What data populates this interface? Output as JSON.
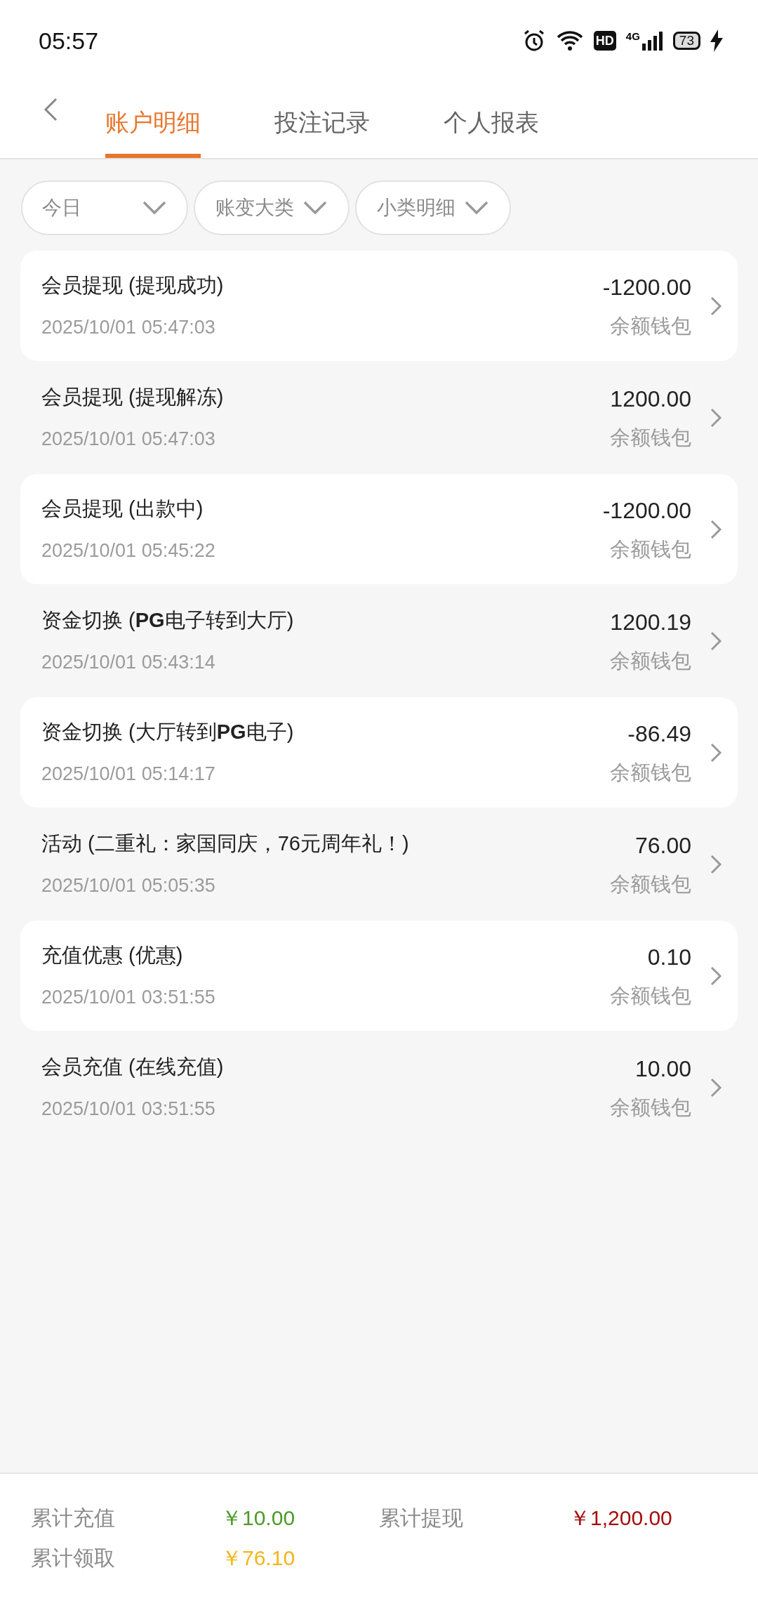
{
  "status_bar": {
    "time": "05:57",
    "hd": "HD",
    "network": "4G",
    "battery": "73"
  },
  "tabs": [
    {
      "label": "账户明细",
      "selected": true
    },
    {
      "label": "投注记录",
      "selected": false
    },
    {
      "label": "个人报表",
      "selected": false
    }
  ],
  "filters": [
    {
      "label": "今日"
    },
    {
      "label": "账变大类"
    },
    {
      "label": "小类明细"
    }
  ],
  "records": [
    {
      "title": "会员提现 (提现成功)",
      "time": "2025/10/01 05:47:03",
      "amount": "-1200.00",
      "wallet": "余额钱包"
    },
    {
      "title": "会员提现 (提现解冻)",
      "time": "2025/10/01 05:47:03",
      "amount": "1200.00",
      "wallet": "余额钱包"
    },
    {
      "title": "会员提现 (出款中)",
      "time": "2025/10/01 05:45:22",
      "amount": "-1200.00",
      "wallet": "余额钱包"
    },
    {
      "title": "资金切换 (**PG**电子转到大厅)",
      "time": "2025/10/01 05:43:14",
      "amount": "1200.19",
      "wallet": "余额钱包"
    },
    {
      "title": "资金切换 (大厅转到**PG**电子)",
      "time": "2025/10/01 05:14:17",
      "amount": "-86.49",
      "wallet": "余额钱包"
    },
    {
      "title": "活动 (二重礼：家国同庆，76元周年礼！)",
      "time": "2025/10/01 05:05:35",
      "amount": "76.00",
      "wallet": "余额钱包"
    },
    {
      "title": "充值优惠 (优惠)",
      "time": "2025/10/01 03:51:55",
      "amount": "0.10",
      "wallet": "余额钱包"
    },
    {
      "title": "会员充值 (在线充值)",
      "time": "2025/10/01 03:51:55",
      "amount": "10.00",
      "wallet": "余额钱包"
    }
  ],
  "summary": [
    {
      "label": "累计充值",
      "value": "￥10.00",
      "color": "#4e9a2a"
    },
    {
      "label": "累计提现",
      "value": "￥1,200.00",
      "color": "#a50e0e"
    },
    {
      "label": "累计领取",
      "value": "￥76.10",
      "color": "#f2b61c"
    }
  ]
}
